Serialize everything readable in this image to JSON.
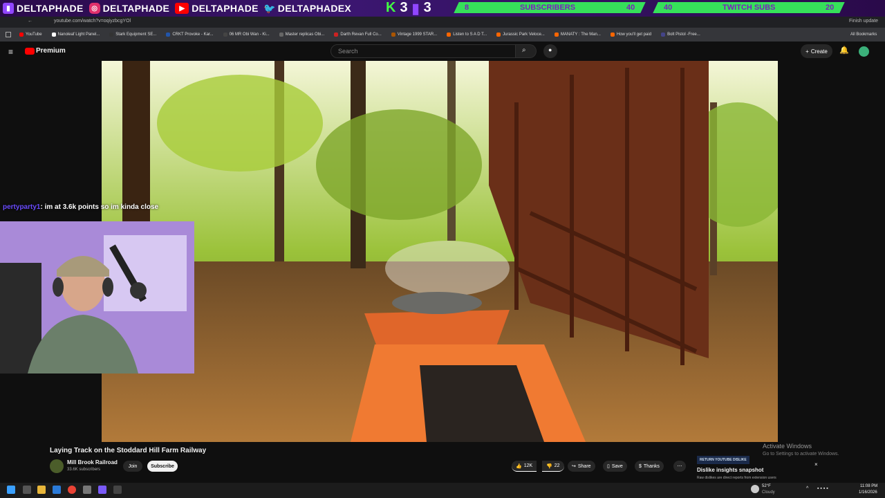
{
  "overlay": {
    "socials": [
      {
        "icon": "twitch-icon",
        "name": "DELTAPHADE",
        "color": "#9146ff"
      },
      {
        "icon": "instagram-icon",
        "name": "DELTAPHADE",
        "color": "#e1306c"
      },
      {
        "icon": "youtube-icon",
        "name": "DELTAPHADE",
        "color": "#ff0000"
      },
      {
        "icon": "twitter-icon",
        "name": "DELTAPHADEX",
        "color": "#1da1f2"
      }
    ],
    "kicks": "3",
    "bits": "3",
    "subscribers_label": "SUBSCRIBERS",
    "subscribers_current": "8",
    "subscribers_goal": "40",
    "subscribers_progress": 0.2,
    "twitch_subs_label": "TWITCH SUBS",
    "twitch_subs_current": "40",
    "twitch_subs_goal": "20",
    "twitch_subs_progress": 1.0
  },
  "browser": {
    "url": "youtube.com/watch?v=oqiyzbcgYOl",
    "update_label": "Finish update",
    "bookmarks": [
      {
        "label": "YouTube",
        "color": "#ff0000"
      },
      {
        "label": "Nanoleaf Light Panel...",
        "color": "#ffffff"
      },
      {
        "label": "Stark Equipment SE...",
        "color": "#333333"
      },
      {
        "label": "CRKT Provoke - Kar...",
        "color": "#2255aa"
      },
      {
        "label": "06 MR Obi Wan - Ki...",
        "color": "#444444"
      },
      {
        "label": "Master replicas Obi...",
        "color": "#666666"
      },
      {
        "label": "Darth Revan Full Co...",
        "color": "#cc2222"
      },
      {
        "label": "Vintage 1999 STAR...",
        "color": "#aa5500"
      },
      {
        "label": "Listen to S A D T...",
        "color": "#ff6600"
      },
      {
        "label": "Jurassic Park Veloce...",
        "color": "#ff6600"
      },
      {
        "label": "MANATY : The Man...",
        "color": "#ff6600"
      },
      {
        "label": "How you'll get paid",
        "color": "#ff6600"
      },
      {
        "label": "Bolt Pistol -Free...",
        "color": "#444488"
      }
    ],
    "all_bookmarks": "All Bookmarks"
  },
  "youtube": {
    "logo": "Premium",
    "search_placeholder": "Search",
    "create_label": "Create",
    "video_title": "Laying Track on the Stoddard Hill Farm Railway",
    "channel_name": "Mill Brook Railroad",
    "channel_subs": "33.6K subscribers",
    "join_label": "Join",
    "subscribe_label": "Subscribe",
    "likes": "12K",
    "dislikes": "22",
    "share_label": "Share",
    "save_label": "Save",
    "thanks_label": "Thanks",
    "dislike_ribbon": "RETURN YOUTUBE DISLIKE",
    "dislike_title": "Dislike insights snapshot",
    "dislike_sub": "Raw dislikes are direct reports from extension users"
  },
  "chat": {
    "user": "pertyparty1",
    "message": ": im at 3.6k points so im kinda close"
  },
  "windows": {
    "activate_title": "Activate Windows",
    "activate_sub": "Go to Settings to activate Windows.",
    "weather_temp": "52°F",
    "weather_desc": "Cloudy",
    "time": "11:08 PM",
    "date": "1/16/2026"
  }
}
